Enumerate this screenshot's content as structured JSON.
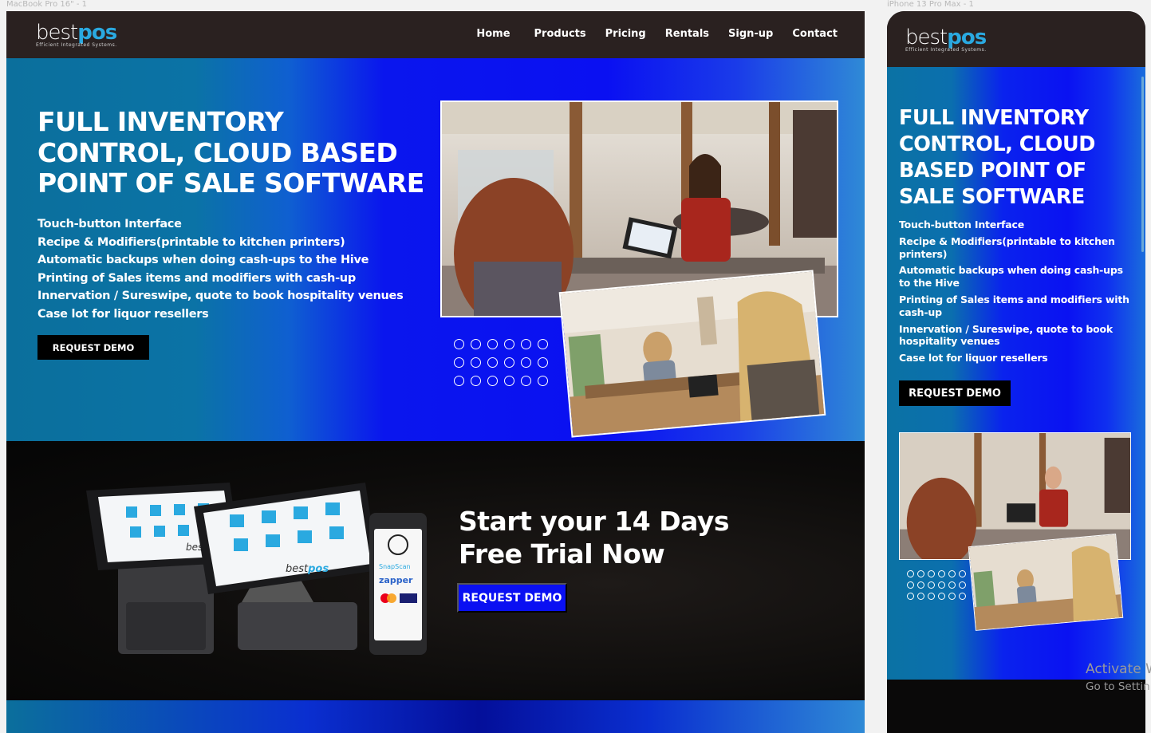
{
  "frames": {
    "desktop_label": "MacBook Pro 16\" - 1",
    "mobile_label": "iPhone 13 Pro Max - 1"
  },
  "brand": {
    "best": "best",
    "pos": "pos",
    "tagline": "Efficient Integrated Systems."
  },
  "nav": {
    "items": [
      "Home",
      "Products",
      "Pricing",
      "Rentals",
      "Sign-up",
      "Contact"
    ]
  },
  "hero": {
    "title": "FULL INVENTORY CONTROL, CLOUD BASED POINT OF SALE SOFTWARE",
    "features": [
      "Touch-button Interface",
      "Recipe & Modifiers(printable to kitchen printers)",
      "Automatic backups when doing cash-ups to the Hive",
      "Printing of Sales items and modifiers with cash-up",
      "Innervation / Sureswipe, quote to book hospitality venues",
      "Case lot for liquor resellers"
    ],
    "cta_label": "REQUEST DEMO"
  },
  "trial": {
    "title": "Start your 14 Days Free Trial Now",
    "cta_label": "REQUEST DEMO",
    "device_brand": "bestpos",
    "terminal_labels": [
      "SnapScan",
      "zapper",
      "VISA"
    ]
  },
  "system_overlay": {
    "line1": "Activate W",
    "line2": "Go to Settin"
  },
  "colors": {
    "nav_bg": "#2a2120",
    "accent_blue": "#0a10f2",
    "brand_cyan": "#2aa9e0",
    "teal": "#0b6f9c"
  }
}
